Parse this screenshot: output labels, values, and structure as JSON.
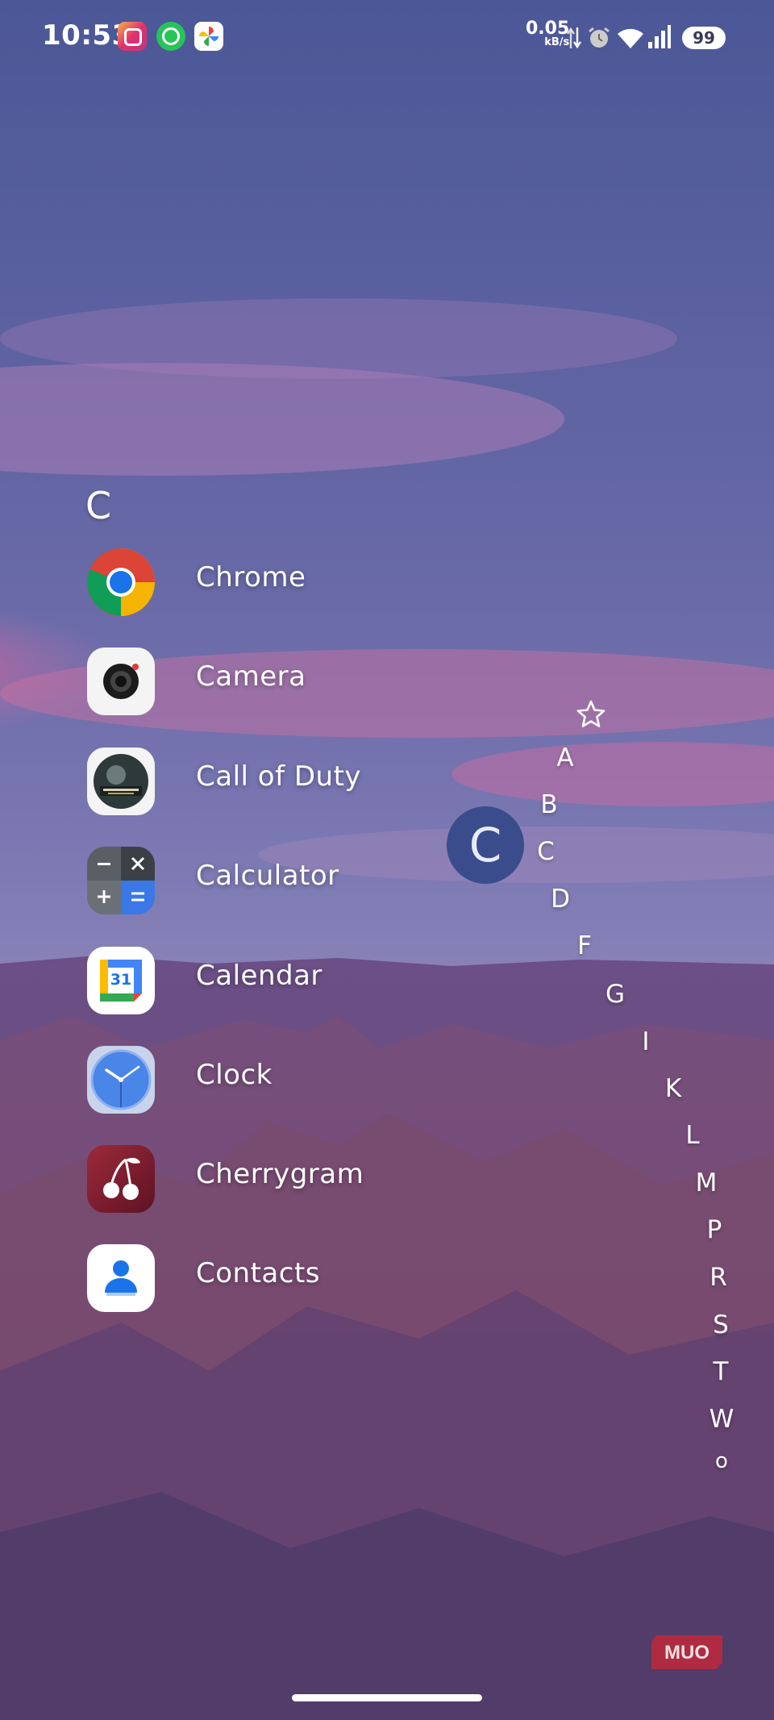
{
  "status_bar": {
    "time": "10:53",
    "notifications": [
      "instagram-icon",
      "whatsapp-icon",
      "google-photos-icon"
    ],
    "net_speed_value": "0.05",
    "net_speed_unit": "kB/s",
    "battery": "99",
    "indicators": [
      "data-transfer-icon",
      "alarm-icon",
      "wifi-icon",
      "cellular-signal-icon",
      "battery-icon"
    ]
  },
  "app_drawer": {
    "section_letter": "C",
    "apps": [
      {
        "label": "Chrome",
        "icon": "chrome-icon"
      },
      {
        "label": "Camera",
        "icon": "camera-icon"
      },
      {
        "label": "Call of Duty",
        "icon": "call-of-duty-icon"
      },
      {
        "label": "Calculator",
        "icon": "calculator-icon"
      },
      {
        "label": "Calendar",
        "icon": "calendar-icon"
      },
      {
        "label": "Clock",
        "icon": "clock-icon"
      },
      {
        "label": "Cherrygram",
        "icon": "cherrygram-icon"
      },
      {
        "label": "Contacts",
        "icon": "contacts-icon"
      }
    ]
  },
  "calendar_date": "31",
  "fast_scroller": {
    "favorites_icon": "star-icon",
    "letters": [
      "A",
      "B",
      "C",
      "D",
      "F",
      "G",
      "I",
      "K",
      "L",
      "M",
      "P",
      "R",
      "S",
      "T",
      "W",
      "o"
    ],
    "active_letter": "C"
  },
  "watermark": "MUO",
  "colors": {
    "bubble": "#3a4c8c",
    "sky_top": "#4d5a9c",
    "canyon": "#6e4a78"
  }
}
